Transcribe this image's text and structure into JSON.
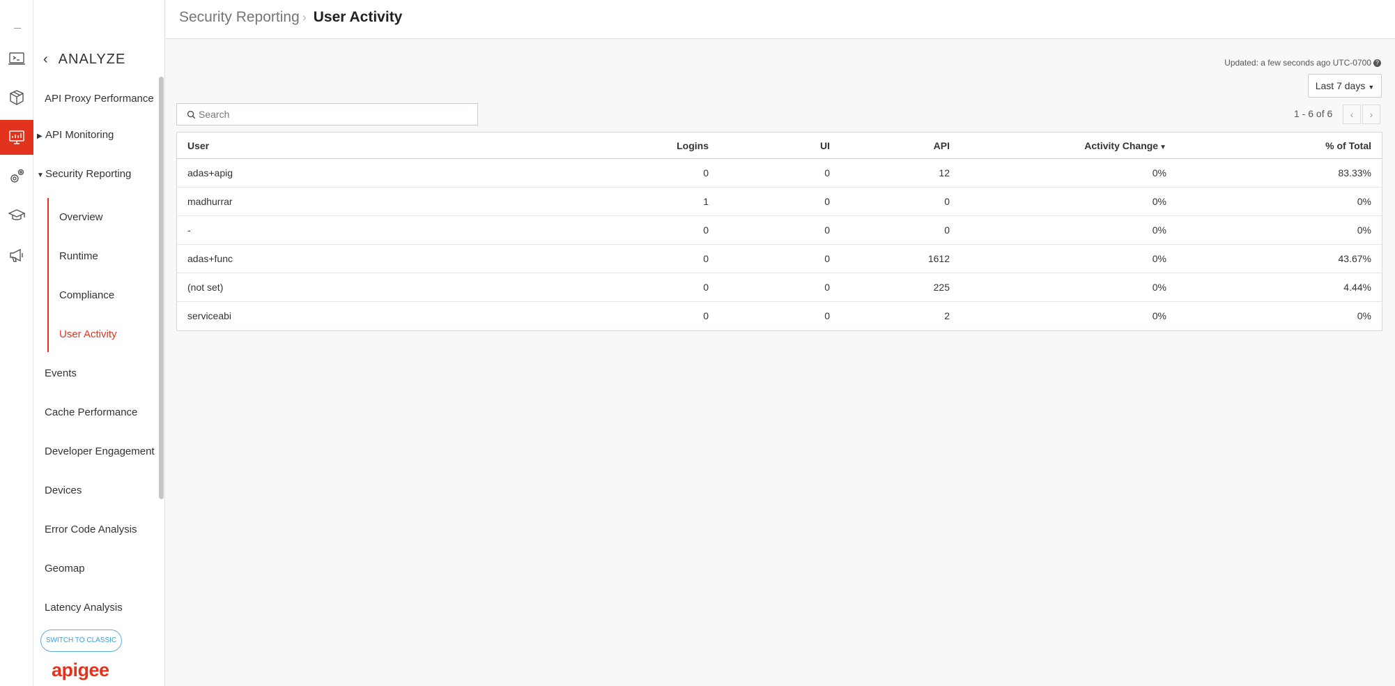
{
  "rail": {
    "icons": [
      "terminal-icon",
      "package-icon",
      "analytics-icon",
      "settings-gears-icon",
      "graduation-cap-icon",
      "megaphone-icon"
    ],
    "accent": "#e2341d"
  },
  "menu": {
    "header": "ANALYZE",
    "items": [
      {
        "label": "API Proxy Performance"
      },
      {
        "label": "API Monitoring"
      },
      {
        "label": "Security Reporting"
      },
      {
        "label": "Events"
      },
      {
        "label": "Cache Performance"
      },
      {
        "label": "Developer Engagement"
      },
      {
        "label": "Devices"
      },
      {
        "label": "Error Code Analysis"
      },
      {
        "label": "Geomap"
      },
      {
        "label": "Latency Analysis"
      }
    ],
    "sub_items": [
      {
        "label": "Overview"
      },
      {
        "label": "Runtime"
      },
      {
        "label": "Compliance"
      },
      {
        "label": "User Activity"
      }
    ],
    "switch_classic": "SWITCH TO CLASSIC",
    "logo": "apigee"
  },
  "breadcrumb": {
    "parent": "Security Reporting",
    "current": "User Activity"
  },
  "toolbar": {
    "updated": "Updated: a few seconds ago UTC-0700",
    "range": "Last 7 days",
    "search_placeholder": "Search",
    "pager": "1 - 6 of 6"
  },
  "table": {
    "columns": [
      "User",
      "Logins",
      "UI",
      "API",
      "Activity Change",
      "% of Total"
    ],
    "rows": [
      {
        "user": "adas+apig",
        "logins": "0",
        "ui": "0",
        "api": "12",
        "change": "0%",
        "pct": "83.33%"
      },
      {
        "user": "madhurrar",
        "logins": "1",
        "ui": "0",
        "api": "0",
        "change": "0%",
        "pct": "0%"
      },
      {
        "user": "-",
        "logins": "0",
        "ui": "0",
        "api": "0",
        "change": "0%",
        "pct": "0%"
      },
      {
        "user": "adas+func",
        "logins": "0",
        "ui": "0",
        "api": "1612",
        "change": "0%",
        "pct": "43.67%"
      },
      {
        "user": "(not set)",
        "logins": "0",
        "ui": "0",
        "api": "225",
        "change": "0%",
        "pct": "4.44%"
      },
      {
        "user": "serviceabi",
        "logins": "0",
        "ui": "0",
        "api": "2",
        "change": "0%",
        "pct": "0%"
      }
    ]
  }
}
